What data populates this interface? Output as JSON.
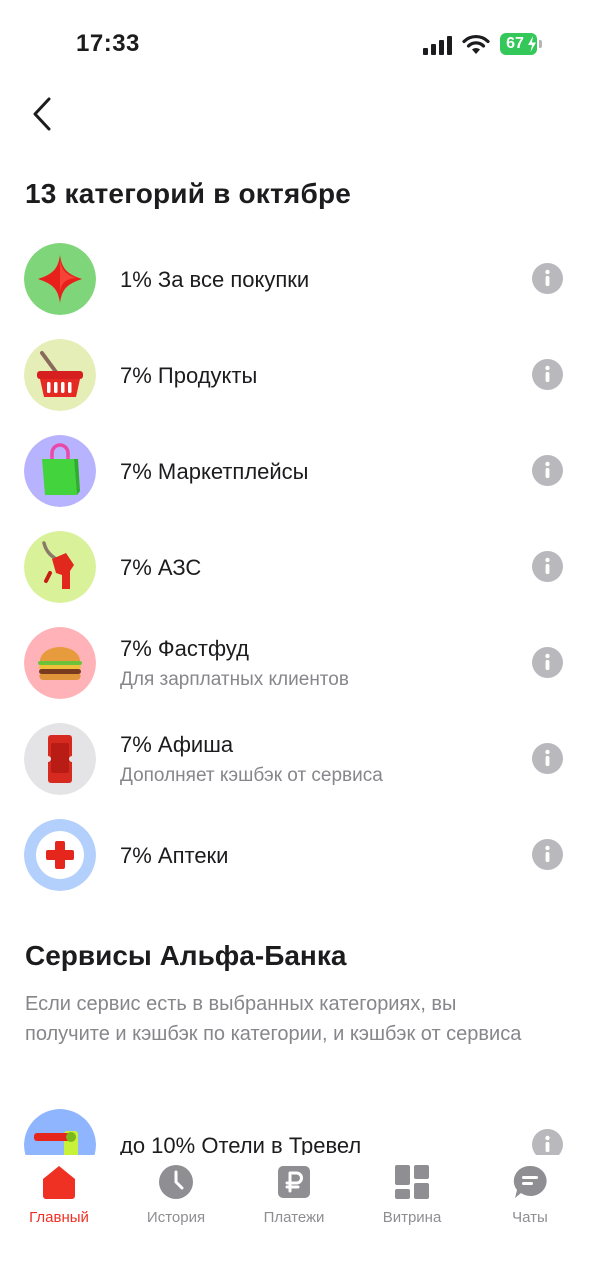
{
  "status_bar": {
    "time": "17:33",
    "battery": "67"
  },
  "page": {
    "title": "13 категорий в октябре"
  },
  "categories": [
    {
      "title": "1% За все покупки",
      "subtitle": "",
      "icon": "red-star-icon",
      "icon_bg": "#7fd67a"
    },
    {
      "title": "7% Продукты",
      "subtitle": "",
      "icon": "shopping-basket-icon",
      "icon_bg": "#e6eeb7"
    },
    {
      "title": "7% Маркетплейсы",
      "subtitle": "",
      "icon": "shopping-bag-icon",
      "icon_bg": "#b8b3ff"
    },
    {
      "title": "7% АЗС",
      "subtitle": "",
      "icon": "fuel-nozzle-icon",
      "icon_bg": "#d9f29a"
    },
    {
      "title": "7% Фастфуд",
      "subtitle": "Для зарплатных клиентов",
      "icon": "burger-icon",
      "icon_bg": "#ffb3b8"
    },
    {
      "title": "7% Афиша",
      "subtitle": "Дополняет кэшбэк от сервиса",
      "icon": "ticket-icon",
      "icon_bg": "#e4e4e6"
    },
    {
      "title": "7% Аптеки",
      "subtitle": "",
      "icon": "medical-cross-icon",
      "icon_bg": "#b3cffc"
    }
  ],
  "services": {
    "title": "Сервисы Альфа-Банка",
    "description": "Если сервис есть в выбранных категориях, вы получите и кэшбэк по категории, и кэшбэк от сервиса",
    "items": [
      {
        "title": "до 10% Отели в Тревел",
        "icon": "hotel-key-icon",
        "icon_bg": "#8fb5ff"
      }
    ]
  },
  "tabs": [
    {
      "label": "Главный",
      "icon": "home-icon",
      "active": true
    },
    {
      "label": "История",
      "icon": "clock-icon",
      "active": false
    },
    {
      "label": "Платежи",
      "icon": "ruble-icon",
      "active": false
    },
    {
      "label": "Витрина",
      "icon": "grid-icon",
      "active": false
    },
    {
      "label": "Чаты",
      "icon": "chat-icon",
      "active": false
    }
  ],
  "colors": {
    "accent": "#ef3124",
    "tab_inactive": "#8e8e93",
    "info_icon": "#b9b9bd"
  }
}
